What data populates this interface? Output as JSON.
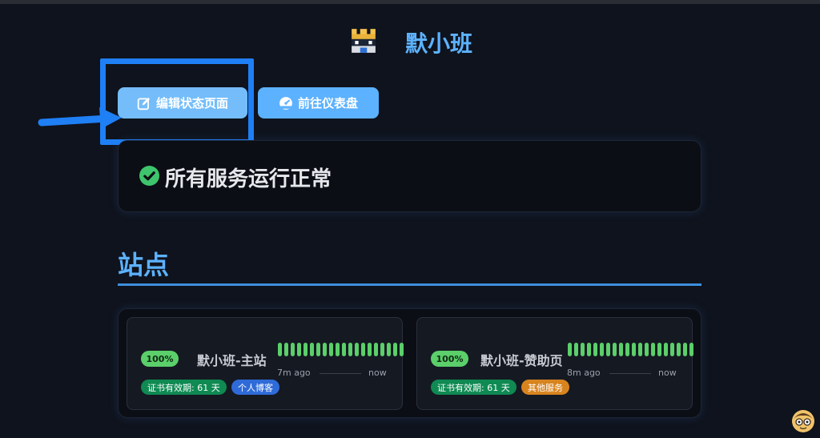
{
  "header": {
    "title": "默小班",
    "logo_icon": "pixel-castle-icon"
  },
  "actions": {
    "edit_label": "编辑状态页面",
    "edit_icon": "edit-icon",
    "dashboard_label": "前往仪表盘",
    "dashboard_icon": "gauge-icon"
  },
  "status": {
    "text": "所有服务运行正常",
    "icon": "check-circle-icon",
    "color": "#3ec46d"
  },
  "section": {
    "title": "站点"
  },
  "monitors": [
    {
      "uptime": "100%",
      "name": "默小班-主站",
      "since": "7m ago",
      "until": "now",
      "cert": "证书有效期: 61 天",
      "tag": "个人博客",
      "tag_color": "#2f6bd8",
      "heartbeats": 20
    },
    {
      "uptime": "100%",
      "name": "默小班-赞助页",
      "since": "8m ago",
      "until": "now",
      "cert": "证书有效期: 61 天",
      "tag": "其他服务",
      "tag_color": "#d8841e",
      "heartbeats": 20
    }
  ],
  "colors": {
    "accent": "#5cb2ff",
    "up": "#5bcf6a",
    "annotation": "#1f7ff5"
  }
}
